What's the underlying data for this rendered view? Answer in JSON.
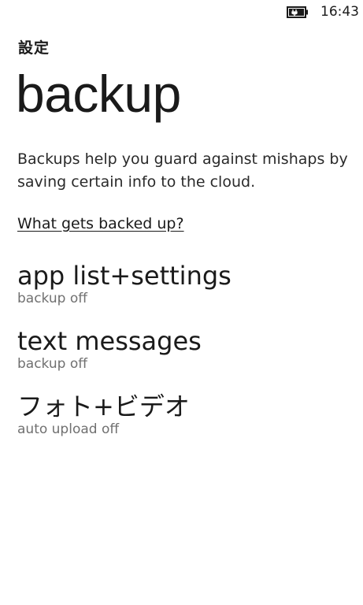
{
  "status_bar": {
    "time": "16:43",
    "battery_icon": "battery-charging-icon"
  },
  "header": {
    "app_title": "設定",
    "page_title": "backup"
  },
  "main": {
    "description": "Backups help you guard against mishaps by saving certain info to the cloud.",
    "link_label": "What gets backed up?",
    "items": [
      {
        "title": "app list+settings",
        "status": "backup off"
      },
      {
        "title": "text messages",
        "status": "backup off"
      },
      {
        "title": "フォト+ビデオ",
        "status": "auto upload off"
      }
    ]
  },
  "colors": {
    "background": "#ffffff",
    "text": "#1a1a1a",
    "subtext": "#707070"
  }
}
